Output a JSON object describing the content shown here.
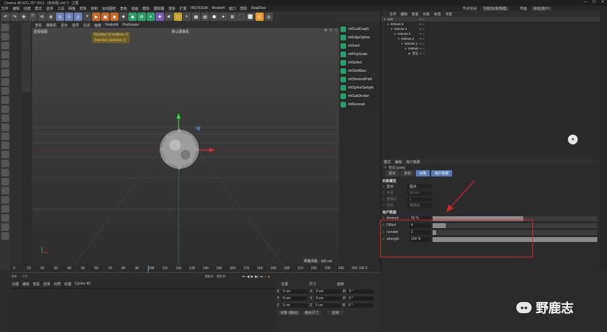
{
  "window": {
    "title": "Cinema 4D R21.207 (RC) - [未标题.c4d *] - 主要"
  },
  "menu": [
    "文件",
    "编辑",
    "创建",
    "模式",
    "选择",
    "工具",
    "网格",
    "样条",
    "体积",
    "运动图形",
    "角色",
    "动画",
    "模拟",
    "跟踪器",
    "渲染",
    "扩展",
    "INSYDIUM",
    "Redshift",
    "窗口",
    "帮助",
    "RealFlow"
  ],
  "node_space": {
    "label": "节点空间:",
    "value": "当前(标准/物理)",
    "layout_label": "界面:",
    "layout_value": "启动(用户)"
  },
  "viewport": {
    "menu": [
      "查看",
      "摄像机",
      "显示",
      "选项",
      "过滤",
      "面板",
      "Redshift",
      "ProRender"
    ],
    "name": "透视视图",
    "camera": "默认摄像机",
    "hud": [
      "Number of emitters: 0",
      "Total live particles: 0"
    ],
    "grid": "网格间距 : 100 cm"
  },
  "plugins": [
    "mtDualGraph",
    "mtEdgeSpline",
    "mtInset",
    "mtPolyScale",
    "mtSelect",
    "mtShellGen",
    "mtShortestPath",
    "mtSplineSample",
    "mtSubDivider",
    "mtRemesh"
  ],
  "objmgr": {
    "menu": [
      "文件",
      "编辑",
      "查看",
      "对象",
      "标签",
      "书签"
    ],
    "items": [
      {
        "name": "com",
        "depth": 0
      },
      {
        "name": "mtInset.5",
        "depth": 1
      },
      {
        "name": "mtInset.4",
        "depth": 2
      },
      {
        "name": "mtInset.3",
        "depth": 3
      },
      {
        "name": "mtInset.2",
        "depth": 4
      },
      {
        "name": "mtInset.1",
        "depth": 5
      },
      {
        "name": "mtInset",
        "depth": 6
      },
      {
        "name": "宝石",
        "depth": 7
      }
    ]
  },
  "attr": {
    "menu": [
      "模式",
      "编辑",
      "用户数据"
    ],
    "object": "空白 [com]",
    "tabs": [
      "基本",
      "坐标",
      "对象",
      "用户数据"
    ],
    "section1": "对象属性",
    "props": [
      {
        "label": "显示",
        "value": "圆点"
      },
      {
        "label": "半径",
        "value": "50 cm"
      },
      {
        "label": "宽高比",
        "value": "1"
      },
      {
        "label": "方向",
        "value": "摄像机"
      }
    ],
    "section2": "用户数据",
    "userdata": [
      {
        "label": "Amount",
        "value": "55 %",
        "frac": 0.55
      },
      {
        "label": "Offset",
        "value": "4",
        "frac": 0.08
      },
      {
        "label": "number",
        "value": "2",
        "frac": 0.02
      },
      {
        "label": "strength",
        "value": "100 %",
        "frac": 1.0
      }
    ]
  },
  "timeline": {
    "ticks": [
      "0",
      "10",
      "20",
      "30",
      "40",
      "50",
      "60",
      "70",
      "80",
      "90",
      "100",
      "110",
      "120",
      "130",
      "140",
      "150",
      "160",
      "170",
      "180",
      "190",
      "200",
      "210",
      "220",
      "230",
      "240",
      "250"
    ],
    "end": "100 F",
    "current": "0 F",
    "start": "0 F",
    "min": "250 F",
    "max": "250 F"
  },
  "materials": {
    "menu": [
      "创建",
      "编辑",
      "查看",
      "选择",
      "材质",
      "纹理",
      "Cycles 4D"
    ]
  },
  "coords": {
    "headers": [
      "位置",
      "尺寸",
      "旋转"
    ],
    "rows": [
      {
        "axis": "X",
        "pos": "0 cm",
        "size": "0 cm",
        "rl": "H",
        "rot": "0 °"
      },
      {
        "axis": "Y",
        "pos": "0 cm",
        "size": "0 cm",
        "rl": "P",
        "rot": "0 °"
      },
      {
        "axis": "Z",
        "pos": "0 cm",
        "size": "0 cm",
        "rl": "B",
        "rot": "0 °"
      }
    ],
    "mode": "对象 (相对)",
    "size_mode": "绝对尺寸",
    "apply": "应用"
  },
  "watermark": "野鹿志",
  "colors": {
    "accent": "#5a7bb5",
    "highlight": "#d42828"
  }
}
